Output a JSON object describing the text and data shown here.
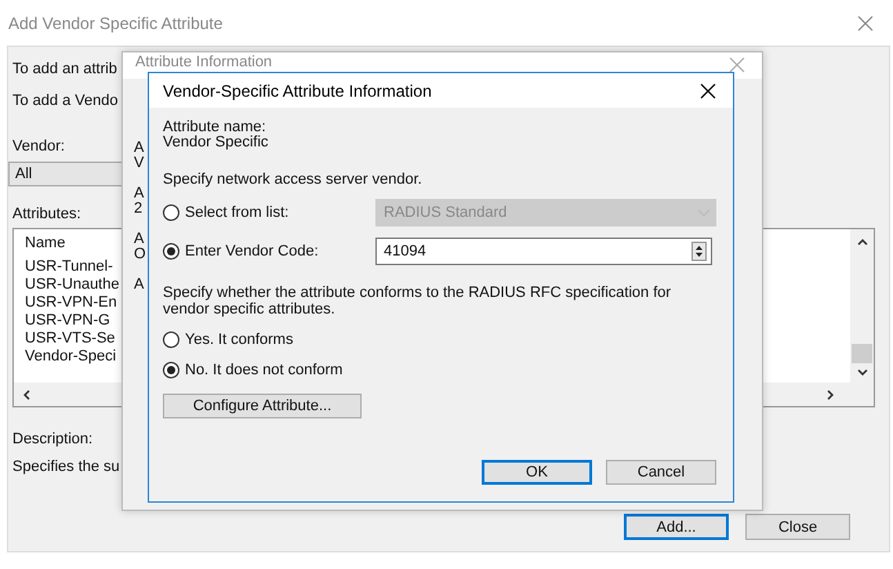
{
  "main_window": {
    "title": "Add Vendor Specific Attribute",
    "intro_lines": [
      "To add an attrib",
      "To add a Vendo"
    ],
    "vendor_label": "Vendor:",
    "vendor_value": "All",
    "attributes_label": "Attributes:",
    "attribute_list": {
      "header": "Name",
      "rows": [
        {
          "name": "USR-Tunnel-"
        },
        {
          "name": "USR-Unauthe"
        },
        {
          "name": "USR-VPN-En"
        },
        {
          "name": "USR-VPN-G"
        },
        {
          "name": "USR-VTS-Se"
        },
        {
          "name": "Vendor-Speci"
        }
      ]
    },
    "description_label": "Description:",
    "description": "Specifies the su",
    "buttons": [
      {
        "label": "Add...",
        "default": true
      },
      {
        "label": "Close",
        "default": false
      }
    ]
  },
  "attribute_info_window": {
    "title": "Attribute Information",
    "fields": [
      {
        "lines": [
          "A",
          "V"
        ]
      },
      {
        "lines": [
          "A",
          "2"
        ]
      },
      {
        "lines": [
          "A",
          "O"
        ]
      },
      {
        "lines": [
          "A"
        ]
      }
    ]
  },
  "vendor_dialog": {
    "title": "Vendor-Specific Attribute Information",
    "attribute_name_label": "Attribute name:",
    "attribute_name": "Vendor Specific",
    "vendor_prompt": "Specify network access server vendor.",
    "vendor_options": [
      {
        "label": "Select from list:",
        "selected": false,
        "kind": "dropdown",
        "value": "RADIUS Standard",
        "disabled": true
      },
      {
        "label": "Enter Vendor Code:",
        "selected": true,
        "kind": "spinner",
        "value": "41094",
        "disabled": false
      }
    ],
    "conform_prompt": "Specify whether the attribute conforms to the RADIUS RFC specification for vendor specific attributes.",
    "conform_options": [
      {
        "label": "Yes. It conforms",
        "selected": false
      },
      {
        "label": "No. It does not conform",
        "selected": true
      }
    ],
    "configure_button": "Configure Attribute...",
    "buttons": [
      {
        "label": "OK",
        "default": true
      },
      {
        "label": "Cancel",
        "default": false
      }
    ]
  }
}
